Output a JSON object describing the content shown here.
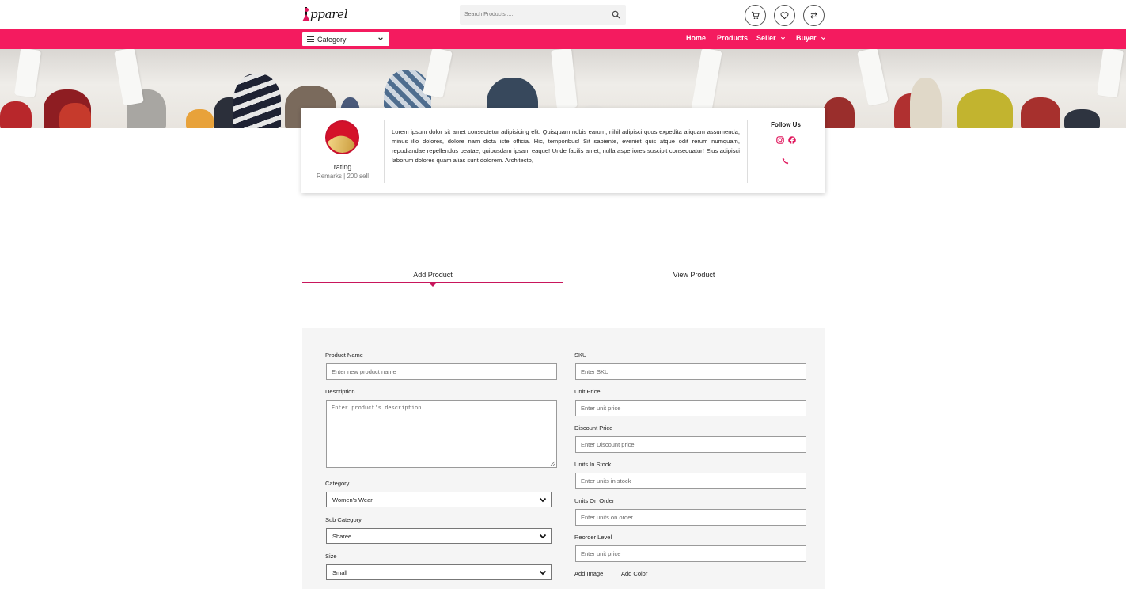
{
  "brand": {
    "logo_text": "pparel"
  },
  "search": {
    "placeholder": "Search Products ...."
  },
  "header": {
    "icons": [
      "cart-icon",
      "heart-icon",
      "compare-icon"
    ]
  },
  "nav": {
    "category_label": "Category",
    "links": {
      "home": "Home",
      "products": "Products",
      "seller": "Seller",
      "buyer": "Buyer"
    },
    "color": "#f41b5f"
  },
  "profile": {
    "rating": "rating",
    "remarks": "Remarks | 200 sell",
    "about": "Lorem ipsum dolor sit amet consectetur adipisicing elit. Quisquam nobis earum, nihil adipisci quos expedita aliquam assumenda, minus illo dolores, dolore nam dicta iste officia. Hic, temporibus! Sit sapiente, eveniet quis atque odit rerum numquam, repudiandae repellendus beatae, quibusdam ipsam eaque! Unde facilis amet, nulla asperiores suscipit consequatur! Eius adipisci laborum dolores quam alias sunt dolorem. Architecto,",
    "follow_us": "Follow Us",
    "social_icons": [
      "instagram-icon",
      "facebook-icon",
      "phone-icon"
    ]
  },
  "tabs": {
    "add_product": "Add Product",
    "view_product": "View Product",
    "active": "add_product"
  },
  "form": {
    "product_name": {
      "label": "Product Name",
      "placeholder": "Enter new product name"
    },
    "description": {
      "label": "Description",
      "placeholder": "Enter product's description"
    },
    "category": {
      "label": "Category",
      "value": "Women's Wear"
    },
    "sub_category": {
      "label": "Sub Category",
      "value": "Sharee"
    },
    "size": {
      "label": "Size",
      "value": "Small"
    },
    "sku": {
      "label": "SKU",
      "placeholder": "Enter SKU"
    },
    "unit_price": {
      "label": "Unit Price",
      "placeholder": "Enter unit price"
    },
    "discount_price": {
      "label": "Discount Price",
      "placeholder": "Enter Discount price"
    },
    "units_in_stock": {
      "label": "Units In Stock",
      "placeholder": "Enter units in stock"
    },
    "units_on_order": {
      "label": "Units On Order",
      "placeholder": "Enter units on order"
    },
    "reorder_level": {
      "label": "Reorder Level",
      "placeholder": "Enter unit price"
    },
    "add_image": "Add Image",
    "add_color": "Add Color"
  }
}
